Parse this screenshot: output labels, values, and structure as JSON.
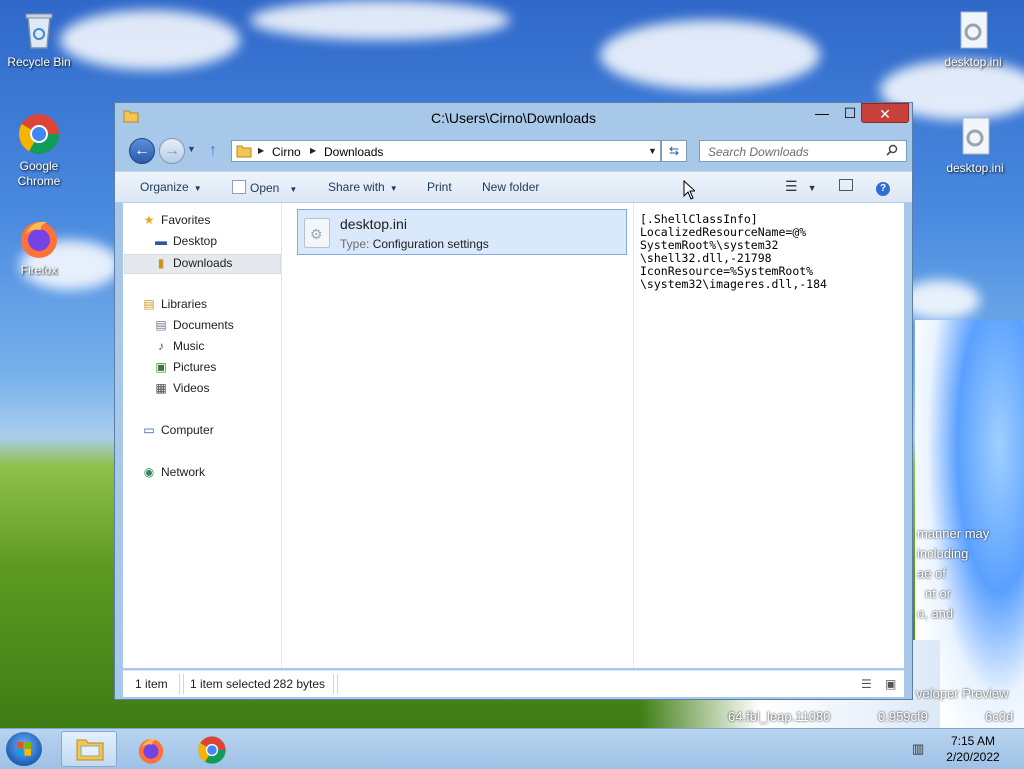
{
  "desktop": {
    "icons": [
      {
        "label": "Recycle Bin"
      },
      {
        "label": "Google Chrome"
      },
      {
        "label": "Firefox"
      },
      {
        "label": "desktop.ini"
      },
      {
        "label": "desktop.ini"
      }
    ],
    "wallpaper_text": [
      "manner may",
      "including",
      "ae of",
      "nt or",
      "o, and",
      "veloper Preview",
      "64.fbl_leap.11080",
      "0.959cf9",
      "6c0d"
    ]
  },
  "window": {
    "title": "C:\\Users\\Cirno\\Downloads",
    "min_glyph": "—",
    "max_glyph": "☐",
    "close_glyph": "✕",
    "breadcrumb": [
      "Cirno",
      "Downloads"
    ],
    "search_placeholder": "Search Downloads",
    "toolbar": {
      "organize": "Organize",
      "open": "Open",
      "share_with": "Share with",
      "print": "Print",
      "new_folder": "New folder"
    },
    "nav_pane": {
      "favorites": "Favorites",
      "desktop": "Desktop",
      "downloads": "Downloads",
      "libraries": "Libraries",
      "documents": "Documents",
      "music": "Music",
      "pictures": "Pictures",
      "videos": "Videos",
      "computer": "Computer",
      "network": "Network"
    },
    "file": {
      "name": "desktop.ini",
      "type_label": "Type:",
      "type_value": "Configuration settings"
    },
    "preview_text": "[.ShellClassInfo]\nLocalizedResourceName=@%\nSystemRoot%\\system32\n\\shell32.dll,-21798\nIconResource=%SystemRoot%\n\\system32\\imageres.dll,-184",
    "status": {
      "item_count": "1 item",
      "selected": "1 item selected",
      "size": "282 bytes"
    }
  },
  "taskbar": {
    "time": "7:15 AM",
    "date": "2/20/2022"
  },
  "colors": {
    "accent": "#3b7bd4",
    "close_red": "#c7413a",
    "selection": "#d9e8fb"
  }
}
